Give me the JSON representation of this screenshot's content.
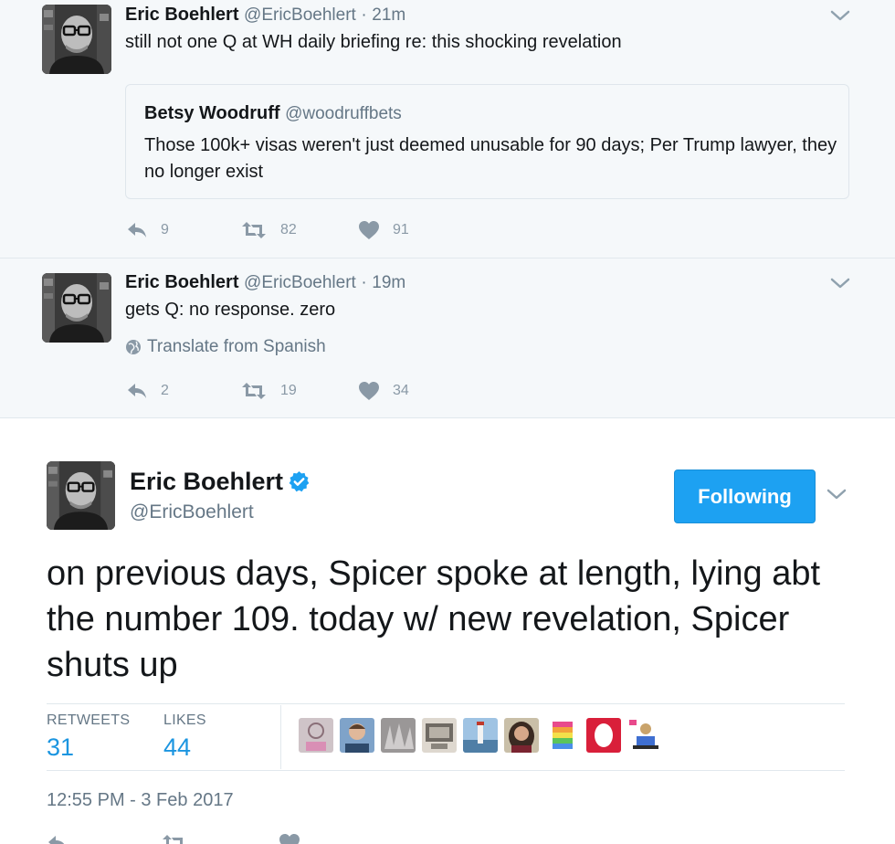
{
  "tweets": [
    {
      "fullname": "Eric Boehlert",
      "handle": "@EricBoehlert",
      "separator": "·",
      "time": "21m",
      "text": "still not one Q at WH daily briefing re: this shocking revelation",
      "quote": {
        "fullname": "Betsy Woodruff",
        "handle": "@woodruffbets",
        "text": "Those 100k+ visas weren't just deemed unusable for 90 days; Per Trump lawyer, they no longer exist"
      },
      "replies": "9",
      "retweets": "82",
      "likes": "91"
    },
    {
      "fullname": "Eric Boehlert",
      "handle": "@EricBoehlert",
      "separator": "·",
      "time": "19m",
      "text": "gets Q: no response. zero",
      "translate": "Translate from Spanish",
      "replies": "2",
      "retweets": "19",
      "likes": "34"
    }
  ],
  "main": {
    "fullname": "Eric Boehlert",
    "handle": "@EricBoehlert",
    "verified": true,
    "follow_label": "Following",
    "text": "on previous days, Spicer spoke at length, lying abt the number 109. today w/ new revelation, Spicer shuts up",
    "retweets_label": "RETWEETS",
    "retweets": "31",
    "likes_label": "LIKES",
    "likes": "44",
    "timestamp": "12:55 PM - 3 Feb 2017"
  },
  "colors": {
    "accent": "#1da1f2",
    "link": "#1b95e0",
    "muted": "#657786",
    "thread_bg": "#f5f8fa"
  },
  "icons": [
    "reply-icon",
    "retweet-icon",
    "heart-icon",
    "chevron-down-icon",
    "verified-badge-icon",
    "globe-icon"
  ]
}
